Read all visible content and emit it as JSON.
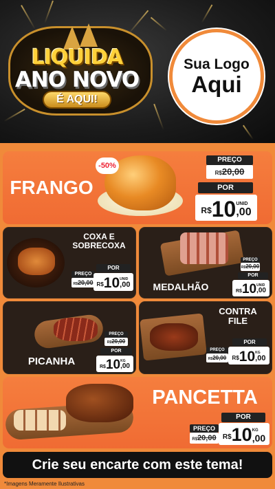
{
  "header": {
    "badge_line1": "LIQUIDA",
    "badge_line2": "ANO NOVO",
    "badge_line3": "É AQUI!",
    "logo_line1": "Sua Logo",
    "logo_line2": "Aqui"
  },
  "labels": {
    "preco": "PREÇO",
    "por": "POR",
    "currency": "R$",
    "unid": "UNID",
    "kg": "KG"
  },
  "products": {
    "frango": {
      "name": "FRANGO",
      "discount": "-50%",
      "old_price": "20,00",
      "price_int": "10",
      "price_dec": ",00",
      "unit": "UNID"
    },
    "coxa": {
      "name_line1": "COXA E",
      "name_line2": "SOBRECOXA",
      "old_price": "20,00",
      "price_int": "10",
      "price_dec": ",00",
      "unit": "UNID"
    },
    "medalhao": {
      "name": "MEDALHÃO",
      "old_price": "20,00",
      "price_int": "10",
      "price_dec": ",00",
      "unit": "UNID"
    },
    "picanha": {
      "name": "PICANHA",
      "old_price": "20,00",
      "price_int": "10",
      "price_dec": ",00",
      "unit": "KG"
    },
    "contrafile": {
      "name_line1": "CONTRA",
      "name_line2": "FILE",
      "old_price": "20,00",
      "price_int": "10",
      "price_dec": ",00",
      "unit": "KG"
    },
    "pancetta": {
      "name": "PANCETTA",
      "old_price": "20,00",
      "price_int": "10",
      "price_dec": ",00",
      "unit": "KG"
    }
  },
  "footer": {
    "cta": "Crie seu encarte com este tema!",
    "disclaimer": "*Imagens Meramente Ilustrativas"
  },
  "colors": {
    "orange": "#f06b33",
    "dark": "#2a1f18",
    "gold": "#ffd13a"
  }
}
